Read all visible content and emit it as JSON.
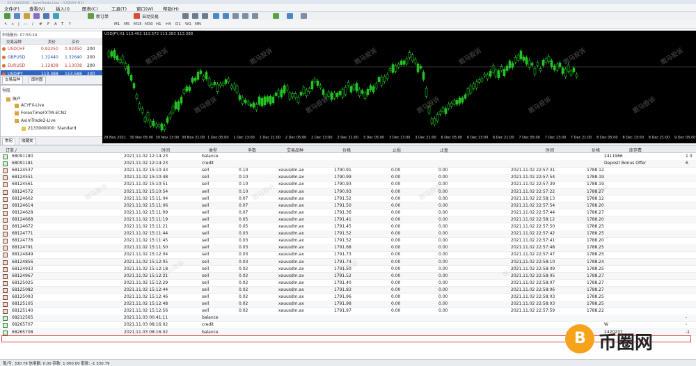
{
  "titlebar": {
    "text": "2133000000 - AximTrade-Live - [USDJPY,H1]"
  },
  "menu": [
    "文件(F)",
    "查看(V)",
    "插入(I)",
    "图表(C)",
    "工具(T)",
    "窗口(W)",
    "帮助(H)"
  ],
  "toolbar": {
    "new_order": "新订单",
    "auto_trading": "自动交易"
  },
  "timeframes": [
    "M1",
    "M5",
    "M15",
    "M30",
    "H1",
    "H4",
    "D1",
    "W1",
    "MN"
  ],
  "market_watch": {
    "time": "市场报价: 07:55:24",
    "headers": [
      "交易品种",
      "卖价",
      "买价",
      ""
    ],
    "rows": [
      {
        "symbol": "USDCHF",
        "bid": "0.92250",
        "ask": "0.92450",
        "spread": "200"
      },
      {
        "symbol": "GBPUSD",
        "bid": "1.32440",
        "ask": "1.32640",
        "spread": "200"
      },
      {
        "symbol": "EURUSD",
        "bid": "1.12838",
        "ask": "1.13038",
        "spread": "200"
      },
      {
        "symbol": "USDJPY",
        "bid": "113.388",
        "ask": "113.588",
        "spread": "200"
      }
    ],
    "tabs": [
      "交易品种",
      "即时图"
    ]
  },
  "navigator": {
    "title": "导航",
    "root": "账户",
    "items": [
      "ACYFX-Live",
      "ForexTimeFXTM-ECN2",
      "AximTrade2-Live",
      "2133000000: Standard"
    ],
    "tabs": [
      "常用",
      "收藏夹"
    ]
  },
  "chart": {
    "info": "USDJPY,H1  113.402 113.572 113.383 113.388",
    "x_labels": [
      "29 Nov 2021",
      "30 Nov 05:00",
      "30 Nov 13:00",
      "30 Nov 21:00",
      "1 Dec 05:00",
      "1 Dec 13:00",
      "1 Dec 21:00",
      "2 Dec 05:00",
      "2 Dec 13:00",
      "2 Dec 21:00",
      "3 Dec 05:00",
      "3 Dec 13:00",
      "3 Dec 21:00",
      "6 Dec 05:00",
      "6 Dec 13:00",
      "6 Dec 21:00",
      "7 Dec 05:00",
      "7 Dec 13:00",
      "7 Dec 21:00",
      "8 Dec 05:00",
      "8 Dec 13:00",
      "8 Dec 21:00",
      "9 Dec 05:00"
    ],
    "watermark": "斑马投诉"
  },
  "terminal": {
    "headers": {
      "order": "订单 /",
      "time": "时间",
      "type": "类型",
      "size": "手数",
      "symbol": "交易品种",
      "price": "价格",
      "sl": "止损",
      "tp": "止盈",
      "close_time": "时间",
      "close_price": "价格",
      "swap": "库存费"
    },
    "rows": [
      {
        "order": "68091180",
        "time": "2021.11.02 12:14:23",
        "type": "balance",
        "size": "",
        "symbol": "",
        "price": "",
        "sl": "",
        "tp": "",
        "close_time": "",
        "close_price": "",
        "swap": "2411966",
        "extra": "1 0"
      },
      {
        "order": "68091181",
        "time": "2021.11.02 12:14:23",
        "type": "credit",
        "size": "",
        "symbol": "",
        "price": "",
        "sl": "",
        "tp": "",
        "close_time": "",
        "close_price": "",
        "swap": "Deposit Bonus Offer",
        "extra": "6"
      },
      {
        "order": "68124537",
        "time": "2021.11.02 15:10:43",
        "type": "sell",
        "size": "0.10",
        "symbol": "xauusdm.ax",
        "price": "1790.91",
        "sl": "0.00",
        "tp": "0.00",
        "close_time": "2021.11.02 22:57:31",
        "close_price": "1788.12",
        "swap": "",
        "extra": ""
      },
      {
        "order": "68124551",
        "time": "2021.11.02 15:10:48",
        "type": "sell",
        "size": "0.10",
        "symbol": "xauusdm.ax",
        "price": "1790.99",
        "sl": "0.00",
        "tp": "0.00",
        "close_time": "2021.11.02 22:57:54",
        "close_price": "1788.19",
        "swap": "",
        "extra": ""
      },
      {
        "order": "68124561",
        "time": "2021.11.02 15:10:51",
        "type": "sell",
        "size": "0.10",
        "symbol": "xauusdm.ax",
        "price": "1790.93",
        "sl": "0.00",
        "tp": "0.00",
        "close_time": "2021.11.02 22:57:39",
        "close_price": "1788.19",
        "swap": "",
        "extra": ""
      },
      {
        "order": "68124572",
        "time": "2021.11.02 15:10:54",
        "type": "sell",
        "size": "0.10",
        "symbol": "xauusdm.ax",
        "price": "1790.93",
        "sl": "0.00",
        "tp": "0.00",
        "close_time": "2021.11.02 22:57:22",
        "close_price": "1788.27",
        "swap": "",
        "extra": ""
      },
      {
        "order": "68124602",
        "time": "2021.11.02 15:11:04",
        "type": "sell",
        "size": "0.07",
        "symbol": "xauusdm.ax",
        "price": "1791.52",
        "sl": "0.00",
        "tp": "0.00",
        "close_time": "2021.11.02 22:58:13",
        "close_price": "1788.12",
        "swap": "",
        "extra": ""
      },
      {
        "order": "68124614",
        "time": "2021.11.02 15:11:06",
        "type": "sell",
        "size": "0.07",
        "symbol": "xauusdm.ax",
        "price": "1791.50",
        "sl": "0.00",
        "tp": "0.00",
        "close_time": "2021.11.02 22:57:54",
        "close_price": "1788.20",
        "swap": "",
        "extra": ""
      },
      {
        "order": "68124628",
        "time": "2021.11.02 15:11:09",
        "type": "sell",
        "size": "0.07",
        "symbol": "xauusdm.ax",
        "price": "1791.36",
        "sl": "0.00",
        "tp": "0.00",
        "close_time": "2021.11.02 22:57:44",
        "close_price": "1788.27",
        "swap": "",
        "extra": ""
      },
      {
        "order": "68124668",
        "time": "2021.11.02 15:11:19",
        "type": "sell",
        "size": "0.05",
        "symbol": "xauusdm.ax",
        "price": "1791.41",
        "sl": "0.00",
        "tp": "0.00",
        "close_time": "2021.11.02 22:58:12",
        "close_price": "1788.20",
        "swap": "",
        "extra": ""
      },
      {
        "order": "68124672",
        "time": "2021.11.02 15:11:21",
        "type": "sell",
        "size": "0.05",
        "symbol": "xauusdm.ax",
        "price": "1791.45",
        "sl": "0.00",
        "tp": "0.00",
        "close_time": "2021.11.02 22:57:50",
        "close_price": "1788.25",
        "swap": "",
        "extra": ""
      },
      {
        "order": "68124771",
        "time": "2021.11.02 15:11:44",
        "type": "sell",
        "size": "0.03",
        "symbol": "xauusdm.ax",
        "price": "1791.52",
        "sl": "0.00",
        "tp": "0.00",
        "close_time": "2021.11.02 22:57:42",
        "close_price": "1788.25",
        "swap": "",
        "extra": ""
      },
      {
        "order": "68124776",
        "time": "2021.11.02 15:11:45",
        "type": "sell",
        "size": "0.03",
        "symbol": "xauusdm.ax",
        "price": "1791.52",
        "sl": "0.00",
        "tp": "0.00",
        "close_time": "2021.11.02 22:57:41",
        "close_price": "1788.20",
        "swap": "",
        "extra": ""
      },
      {
        "order": "68124791",
        "time": "2021.11.02 15:11:50",
        "type": "sell",
        "size": "0.03",
        "symbol": "xauusdm.ax",
        "price": "1791.68",
        "sl": "0.00",
        "tp": "0.00",
        "close_time": "2021.11.02 22:57:48",
        "close_price": "1788.25",
        "swap": "",
        "extra": ""
      },
      {
        "order": "68124849",
        "time": "2021.11.02 15:12:04",
        "type": "sell",
        "size": "0.03",
        "symbol": "xauusdm.ax",
        "price": "1791.73",
        "sl": "0.00",
        "tp": "0.00",
        "close_time": "2021.11.02 22:57:47",
        "close_price": "1788.25",
        "swap": "",
        "extra": ""
      },
      {
        "order": "68124856",
        "time": "2021.11.02 15:12:05",
        "type": "sell",
        "size": "0.03",
        "symbol": "xauusdm.ax",
        "price": "1791.74",
        "sl": "0.00",
        "tp": "0.00",
        "close_time": "2021.11.02 22:58:10",
        "close_price": "1788.24",
        "swap": "",
        "extra": ""
      },
      {
        "order": "68124933",
        "time": "2021.11.02 15:12:18",
        "type": "sell",
        "size": "0.02",
        "symbol": "xauusdm.ax",
        "price": "1791.50",
        "sl": "0.00",
        "tp": "0.00",
        "close_time": "2021.11.02 22:58:09",
        "close_price": "1788.25",
        "swap": "",
        "extra": ""
      },
      {
        "order": "68124967",
        "time": "2021.11.02 15:12:21",
        "type": "sell",
        "size": "0.02",
        "symbol": "xauusdm.ax",
        "price": "1791.52",
        "sl": "0.00",
        "tp": "0.00",
        "close_time": "2021.11.02 22:58:05",
        "close_price": "1788.27",
        "swap": "",
        "extra": ""
      },
      {
        "order": "68125025",
        "time": "2021.11.02 15:12:29",
        "type": "sell",
        "size": "0.02",
        "symbol": "xauusdm.ax",
        "price": "1791.40",
        "sl": "0.00",
        "tp": "0.00",
        "close_time": "2021.11.02 22:58:07",
        "close_price": "1788.27",
        "swap": "",
        "extra": ""
      },
      {
        "order": "68125082",
        "time": "2021.11.02 15:12:44",
        "type": "sell",
        "size": "0.02",
        "symbol": "xauusdm.ax",
        "price": "1791.83",
        "sl": "0.00",
        "tp": "0.00",
        "close_time": "2021.11.02 22:58:06",
        "close_price": "1788.27",
        "swap": "",
        "extra": ""
      },
      {
        "order": "68125093",
        "time": "2021.11.02 15:12:46",
        "type": "sell",
        "size": "0.02",
        "symbol": "xauusdm.ax",
        "price": "1791.96",
        "sl": "0.00",
        "tp": "0.00",
        "close_time": "2021.11.02 22:58:03",
        "close_price": "1788.25",
        "swap": "",
        "extra": ""
      },
      {
        "order": "68125105",
        "time": "2021.11.02 15:12:48",
        "type": "sell",
        "size": "0.02",
        "symbol": "xauusdm.ax",
        "price": "1791.98",
        "sl": "0.00",
        "tp": "0.00",
        "close_time": "2021.11.02 22:58:03",
        "close_price": "1788.25",
        "swap": "",
        "extra": ""
      },
      {
        "order": "68125140",
        "time": "2021.11.02 15:12:56",
        "type": "sell",
        "size": "0.02",
        "symbol": "xauusdm.ax",
        "price": "1791.97",
        "sl": "0.00",
        "tp": "0.00",
        "close_time": "2021.11.02 22:57:59",
        "close_price": "1788.22",
        "swap": "",
        "extra": ""
      },
      {
        "order": "68212565",
        "time": "2021.11.03 00:41:11",
        "type": "balance",
        "size": "",
        "symbol": "",
        "price": "",
        "sl": "",
        "tp": "",
        "close_time": "",
        "close_price": "",
        "swap": "",
        "extra": "-"
      },
      {
        "order": "68265707",
        "time": "2021.11.03 08:16:02",
        "type": "credit",
        "size": "",
        "symbol": "",
        "price": "",
        "sl": "",
        "tp": "",
        "close_time": "",
        "close_price": "",
        "swap": "W",
        "extra": "-"
      },
      {
        "order": "68265708",
        "time": "2021.11.03 08:16:02",
        "type": "balance",
        "size": "",
        "symbol": "",
        "price": "",
        "sl": "",
        "tp": "",
        "close_time": "",
        "close_price": "",
        "swap": "2420237",
        "extra": "-1"
      }
    ]
  },
  "status": {
    "text": "盈/亏: 330.79  信用额: 0.00  存款: 1 000.00  取款: -1 330.79"
  },
  "brand": {
    "text": "币圈网",
    "mark": "B"
  },
  "colors": {
    "chart_bg": "#000000",
    "candle": "#22c322",
    "highlight": "#e0413a",
    "brand": "#f7a21b"
  }
}
